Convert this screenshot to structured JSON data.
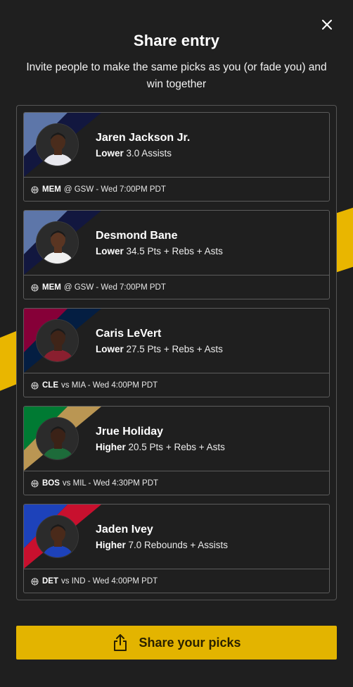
{
  "modal": {
    "title": "Share entry",
    "subtitle": "Invite people to make the same picks as you (or fade you) and win together",
    "close_icon": "close-icon"
  },
  "picks": [
    {
      "player": "Jaren Jackson Jr.",
      "direction": "Lower",
      "line": "3.0 Assists",
      "team": "MEM",
      "matchup": "@ GSW - Wed 7:00PM PDT",
      "colors": [
        "#5d76a9",
        "#12173f"
      ],
      "jersey": "#e8e8ee",
      "skin": "#4a2c1c"
    },
    {
      "player": "Desmond Bane",
      "direction": "Lower",
      "line": "34.5 Pts + Rebs + Asts",
      "team": "MEM",
      "matchup": "@ GSW - Wed 7:00PM PDT",
      "colors": [
        "#5d76a9",
        "#12173f"
      ],
      "jersey": "#f0f0f0",
      "skin": "#5a3522"
    },
    {
      "player": "Caris LeVert",
      "direction": "Lower",
      "line": "27.5 Pts + Rebs + Asts",
      "team": "CLE",
      "matchup": "vs MIA - Wed 4:00PM PDT",
      "colors": [
        "#860038",
        "#041e42"
      ],
      "jersey": "#8a1f2f",
      "skin": "#3f2418"
    },
    {
      "player": "Jrue Holiday",
      "direction": "Higher",
      "line": "20.5 Pts + Rebs + Asts",
      "team": "BOS",
      "matchup": "vs MIL - Wed 4:30PM PDT",
      "colors": [
        "#007a33",
        "#ba9653"
      ],
      "jersey": "#1d6b3a",
      "skin": "#3b2217"
    },
    {
      "player": "Jaden Ivey",
      "direction": "Higher",
      "line": "7.0 Rebounds + Assists",
      "team": "DET",
      "matchup": "vs IND - Wed 4:00PM PDT",
      "colors": [
        "#1d42ba",
        "#c8102e"
      ],
      "jersey": "#1d42ba",
      "skin": "#4a2a1a"
    }
  ],
  "share_button": {
    "label": "Share your picks",
    "icon": "share-icon",
    "color": "#e3b400"
  },
  "accent_color": "#e9b600",
  "ball_icon": "basketball-icon"
}
